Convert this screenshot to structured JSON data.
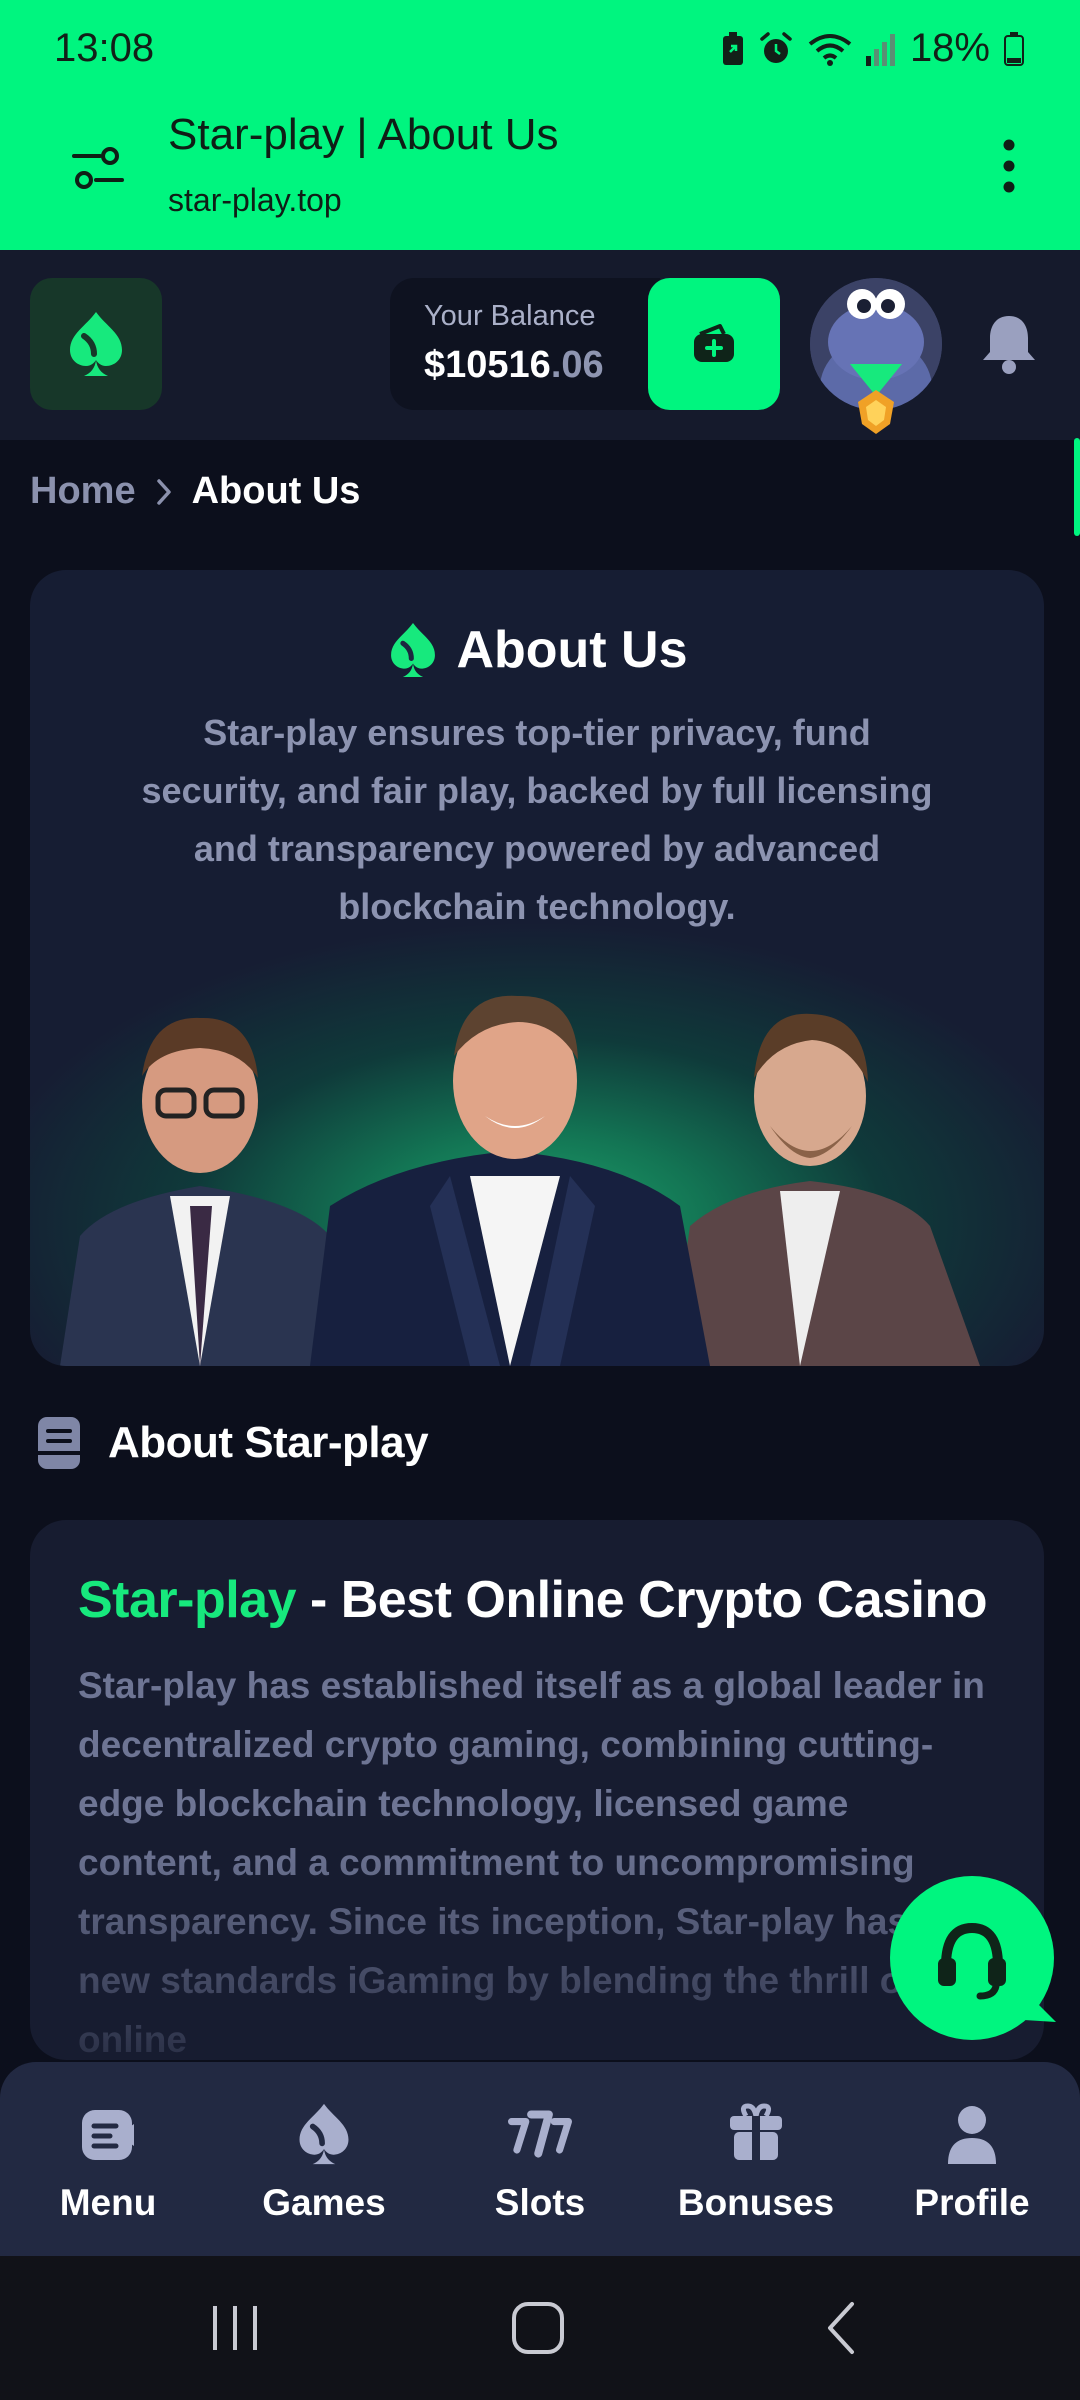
{
  "status_bar": {
    "time": "13:08",
    "battery": "18%"
  },
  "browser": {
    "title": "Star-play | About Us",
    "url": "star-play.top"
  },
  "header": {
    "balance_label": "Your Balance",
    "balance_main": "$10516",
    "balance_cents": ".06"
  },
  "breadcrumb": {
    "home": "Home",
    "current": "About Us"
  },
  "hero": {
    "title": "About Us",
    "text": "Star-play ensures top-tier privacy, fund security, and fair play, backed by full licensing and transparency powered by advanced blockchain technology."
  },
  "section": {
    "title": "About Star-play"
  },
  "article": {
    "brand": "Star-play",
    "title_rest": " - Best Online Crypto Casino",
    "body": "Star-play has established itself as a global leader in decentralized crypto gaming, combining cutting-edge blockchain technology, licensed game content, and a commitment to uncompromising transparency. Since its inception, Star-play has set new standards iGaming by blending the thrill of online"
  },
  "bottom_nav": [
    {
      "label": "Menu",
      "icon": "menu-icon"
    },
    {
      "label": "Games",
      "icon": "games-icon"
    },
    {
      "label": "Slots",
      "icon": "slots-icon"
    },
    {
      "label": "Bonuses",
      "icon": "bonuses-icon"
    },
    {
      "label": "Profile",
      "icon": "profile-icon"
    }
  ],
  "colors": {
    "accent": "#00f57f",
    "background": "#0c0f1c",
    "card": "#171c30",
    "muted_text": "#8c93b0"
  }
}
